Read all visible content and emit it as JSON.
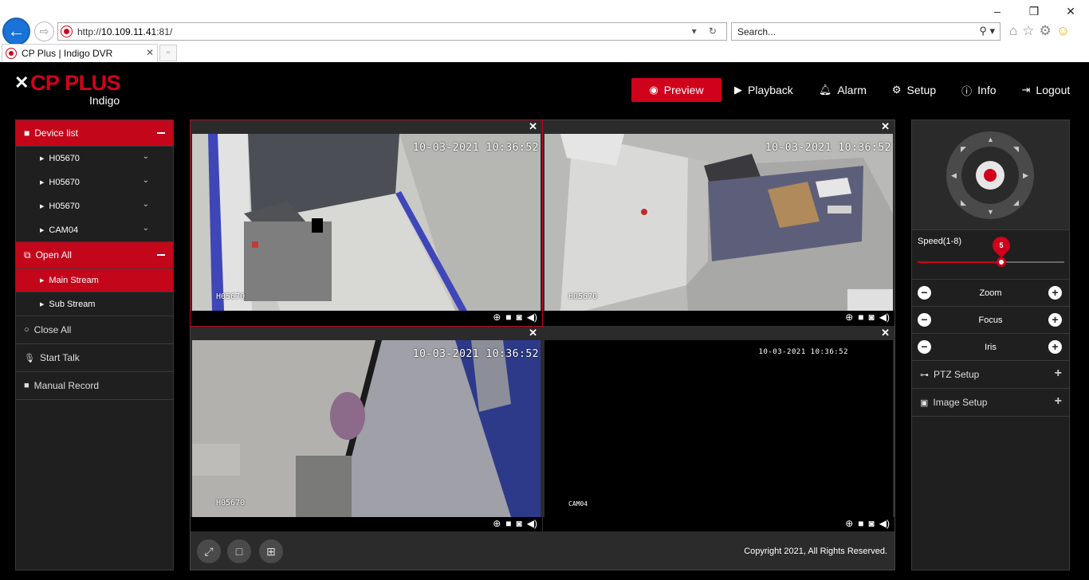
{
  "browser": {
    "url_prefix": "http://",
    "url_host": "10.109.11.41",
    "url_suffix": ":81/",
    "search_placeholder": "Search...",
    "tab_title": "CP Plus | Indigo DVR"
  },
  "app": {
    "brand": "CP PLUS",
    "brand_sub": "Indigo",
    "accent": "#d0021b"
  },
  "nav": [
    {
      "label": "Preview",
      "icon": "eye-icon",
      "active": true
    },
    {
      "label": "Playback",
      "icon": "play-circle-icon"
    },
    {
      "label": "Alarm",
      "icon": "bell-icon"
    },
    {
      "label": "Setup",
      "icon": "gear-icon"
    },
    {
      "label": "Info",
      "icon": "info-icon"
    },
    {
      "label": "Logout",
      "icon": "logout-icon"
    }
  ],
  "left": {
    "device_list_label": "Device list",
    "devices": [
      "H05670",
      "H05670",
      "H05670",
      "CAM04"
    ],
    "open_all_label": "Open All",
    "streams": [
      "Main Stream",
      "Sub Stream"
    ],
    "close_all_label": "Close All",
    "start_talk_label": "Start Talk",
    "manual_record_label": "Manual Record"
  },
  "cells": [
    {
      "timestamp": "10-03-2021 10:36:52",
      "camera": "H05670"
    },
    {
      "timestamp": "10-03-2021 10:36:52",
      "camera": "H05670"
    },
    {
      "timestamp": "10-03-2021 10:36:52",
      "camera": "H05670"
    },
    {
      "timestamp": "10-03-2021 10:36:52",
      "camera": "CAM04"
    }
  ],
  "footer": {
    "copyright": "Copyright 2021, All Rights Reserved."
  },
  "right": {
    "speed_label": "Speed(1-8)",
    "speed_value": "5",
    "speed_fraction": 0.57,
    "zoom_label": "Zoom",
    "focus_label": "Focus",
    "iris_label": "Iris",
    "ptz_setup_label": "PTZ Setup",
    "image_setup_label": "Image Setup"
  }
}
